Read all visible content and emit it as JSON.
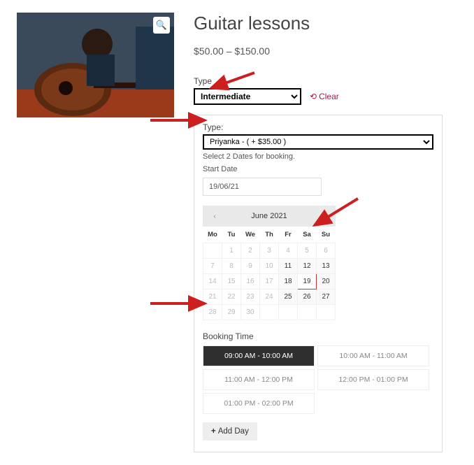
{
  "product": {
    "title": "Guitar lessons",
    "price_range": "$50.00 – $150.00"
  },
  "variation": {
    "label": "Type",
    "selected": "Intermediate",
    "clear_label": "Clear"
  },
  "booking": {
    "teacher_label": "Type:",
    "teacher_selected": "Priyanka - ( + $35.00 )",
    "helper": "Select 2 Dates for booking.",
    "start_date_label": "Start Date",
    "start_date_value": "19/06/21",
    "booking_time_label": "Booking Time",
    "add_day_label": "Add Day"
  },
  "calendar": {
    "month_label": "June 2021",
    "dow": [
      "Mo",
      "Tu",
      "We",
      "Th",
      "Fr",
      "Sa",
      "Su"
    ],
    "weeks": [
      [
        {
          "d": ""
        },
        {
          "d": "1"
        },
        {
          "d": "2"
        },
        {
          "d": "3"
        },
        {
          "d": "4"
        },
        {
          "d": "5"
        },
        {
          "d": "6"
        }
      ],
      [
        {
          "d": "7"
        },
        {
          "d": "8"
        },
        {
          "d": "9"
        },
        {
          "d": "10"
        },
        {
          "d": "11",
          "a": true
        },
        {
          "d": "12",
          "a": true
        },
        {
          "d": "13",
          "a": true
        }
      ],
      [
        {
          "d": "14"
        },
        {
          "d": "15"
        },
        {
          "d": "16"
        },
        {
          "d": "17"
        },
        {
          "d": "18",
          "a": true
        },
        {
          "d": "19",
          "a": true,
          "s": true
        },
        {
          "d": "20",
          "a": true
        }
      ],
      [
        {
          "d": "21"
        },
        {
          "d": "22"
        },
        {
          "d": "23"
        },
        {
          "d": "24"
        },
        {
          "d": "25",
          "a": true
        },
        {
          "d": "26",
          "a": true
        },
        {
          "d": "27",
          "a": true
        }
      ],
      [
        {
          "d": "28"
        },
        {
          "d": "29"
        },
        {
          "d": "30"
        },
        {
          "d": ""
        },
        {
          "d": ""
        },
        {
          "d": ""
        },
        {
          "d": ""
        }
      ]
    ]
  },
  "slots": [
    {
      "label": "09:00 AM - 10:00 AM",
      "selected": true
    },
    {
      "label": "10:00 AM - 11:00 AM"
    },
    {
      "label": "11:00 AM - 12:00 PM"
    },
    {
      "label": "12:00 PM - 01:00 PM"
    },
    {
      "label": "01:00 PM - 02:00 PM"
    }
  ],
  "annotations": {
    "arrow_color": "#cc1f1f"
  }
}
